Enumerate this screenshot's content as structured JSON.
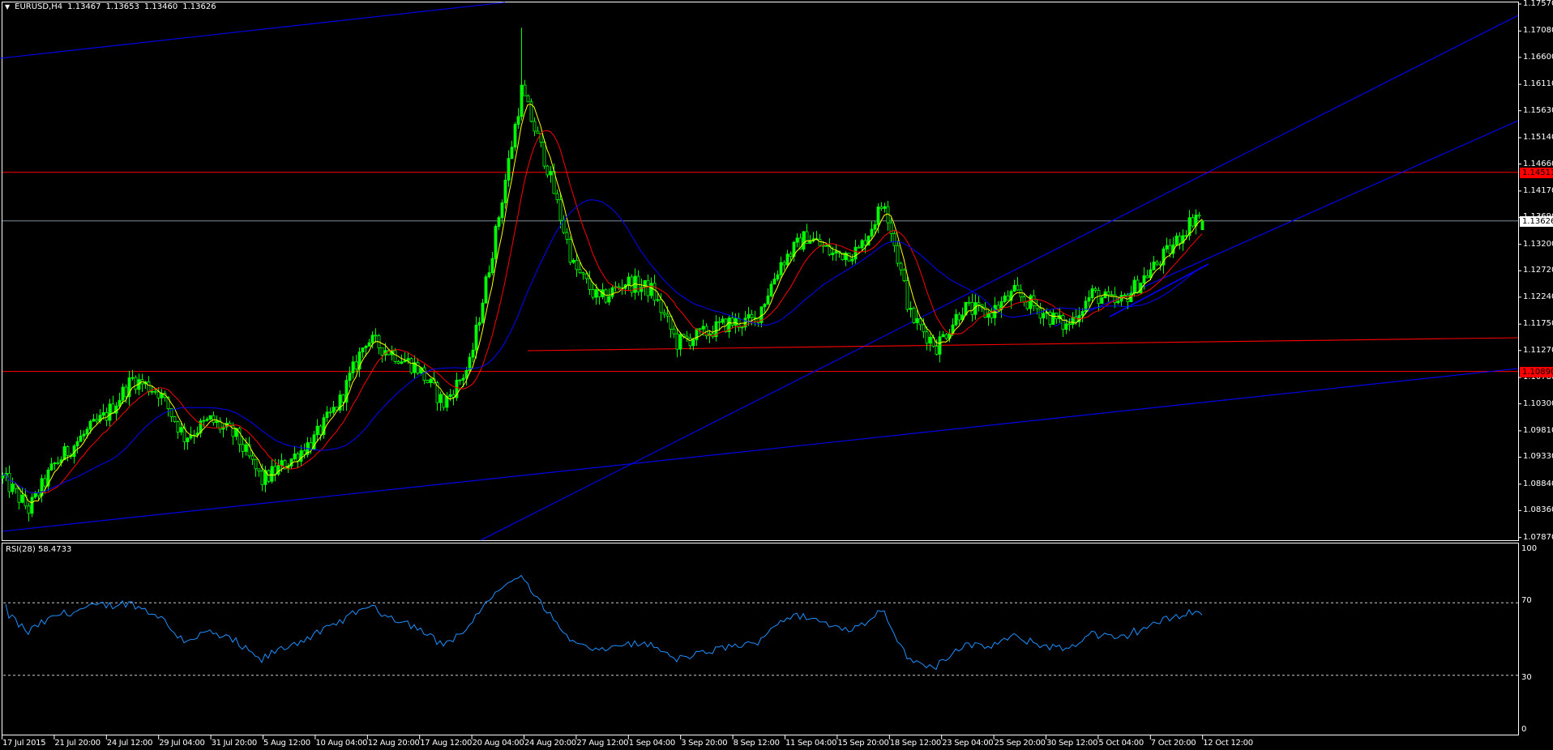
{
  "header": {
    "menu_icon": "triangle-down-icon",
    "symbol_timeframe": "EURUSD,H4",
    "open": "1.13467",
    "high": "1.13653",
    "low": "1.13460",
    "close": "1.13626"
  },
  "price_axis": {
    "labels": [
      "1.17570",
      "1.17080",
      "1.16600",
      "1.16110",
      "1.15630",
      "1.15140",
      "1.14660",
      "1.14170",
      "1.13690",
      "1.13200",
      "1.12720",
      "1.12240",
      "1.11750",
      "1.11270",
      "1.10780",
      "1.10300",
      "1.09810",
      "1.09330",
      "1.08840",
      "1.08360",
      "1.07870"
    ],
    "current_price": "1.13626",
    "horizontal_lines": [
      {
        "label": "1.14511",
        "color": "#ff0000"
      },
      {
        "label": "1.10890",
        "color": "#ff0000"
      }
    ]
  },
  "time_axis": {
    "labels": [
      "17 Jul 2015",
      "21 Jul 20:00",
      "24 Jul 12:00",
      "29 Jul 04:00",
      "31 Jul 20:00",
      "5 Aug 12:00",
      "10 Aug 04:00",
      "12 Aug 20:00",
      "17 Aug 12:00",
      "20 Aug 04:00",
      "24 Aug 20:00",
      "27 Aug 12:00",
      "1 Sep 04:00",
      "3 Sep 20:00",
      "8 Sep 12:00",
      "11 Sep 04:00",
      "15 Sep 20:00",
      "18 Sep 12:00",
      "23 Sep 04:00",
      "25 Sep 20:00",
      "30 Sep 12:00",
      "5 Oct 04:00",
      "7 Oct 20:00",
      "12 Oct 12:00"
    ]
  },
  "rsi": {
    "label": "RSI(28) 58.4733",
    "levels": [
      "100",
      "70",
      "30",
      "0"
    ],
    "color": "#1e90ff"
  },
  "colors": {
    "background": "#000000",
    "candle": "#00ff00",
    "ma_fast": "#ffff00",
    "ma_mid": "#ff0000",
    "ma_slow": "#0000ff",
    "trendline_blue": "#0000ff",
    "trendline_red": "#ff0000",
    "current_price_line": "#7f8c98"
  },
  "chart_data": {
    "type": "candlestick",
    "symbol": "EURUSD",
    "timeframe": "H4",
    "ylim": [
      1.0787,
      1.1757
    ],
    "close_path": [
      1.0895,
      1.0838,
      1.092,
      1.0968,
      1.101,
      1.1075,
      1.1053,
      1.097,
      1.1,
      1.097,
      1.089,
      1.0925,
      1.0965,
      1.1035,
      1.1147,
      1.1124,
      1.1095,
      1.103,
      1.11,
      1.134,
      1.16,
      1.146,
      1.128,
      1.1217,
      1.1252,
      1.1237,
      1.1141,
      1.1157,
      1.1177,
      1.118,
      1.1287,
      1.1336,
      1.1302,
      1.1308,
      1.14,
      1.119,
      1.1135,
      1.1205,
      1.1193,
      1.1231,
      1.12,
      1.117,
      1.123,
      1.121,
      1.126,
      1.131,
      1.1375,
      1.13626
    ],
    "period_high": 1.1714,
    "last_bar": {
      "open": 1.13467,
      "high": 1.13653,
      "low": 1.1346,
      "close": 1.13626
    }
  }
}
